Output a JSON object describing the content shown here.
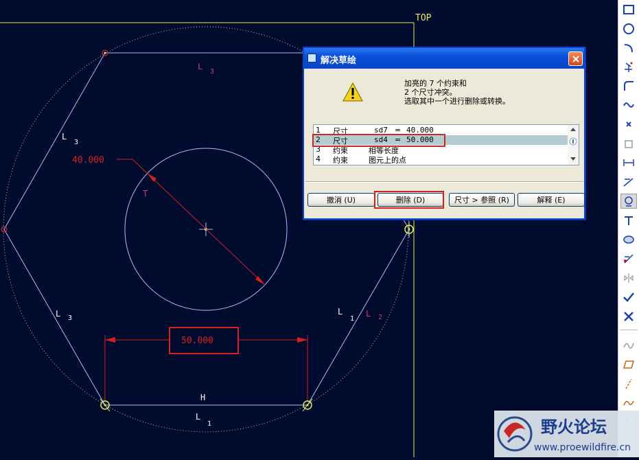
{
  "sketch": {
    "view_label": "TOP",
    "dim_diameter": "40.000",
    "dim_width": "50.000",
    "constraint_labels": {
      "L3_top": [
        "L",
        "3"
      ],
      "L3_upper_left": [
        "L",
        "3"
      ],
      "L3_lower_left": [
        "L",
        "3"
      ],
      "L1_right": [
        "L",
        "1"
      ],
      "L2_right": [
        "L",
        "2"
      ],
      "L1_bottom": [
        "L",
        "1"
      ],
      "H_bottom": "H",
      "T_circle": "T"
    },
    "colors": {
      "background": "#000b2e",
      "geometry": "#a3c2ff",
      "dimension": "#d71f1f",
      "constraint": "#c83c6a",
      "reference_line": "#e8e85a"
    }
  },
  "dialog": {
    "title": "解决草绘",
    "close_icon": "close-icon",
    "warning_icon": "warning-icon",
    "message": {
      "line1": "加亮的 7 个约束和",
      "line2": "2 个尺寸冲突。",
      "line3": "选取其中一个进行删除或转换。"
    },
    "list_items": [
      {
        "num": "1",
        "type": "尺寸",
        "name": "sd7",
        "eq": "=",
        "value": "40.000"
      },
      {
        "num": "2",
        "type": "尺寸",
        "name": "sd4",
        "eq": "=",
        "value": "50.000"
      },
      {
        "num": "3",
        "type": "约束",
        "desc": "相等长度"
      },
      {
        "num": "4",
        "type": "约束",
        "desc": "图元上的点"
      }
    ],
    "selected_index": 1,
    "buttons": {
      "undo": "撤消 (U)",
      "delete": "删除 (D)",
      "dim_to_ref": "尺寸 > 参照 (R)",
      "explain": "解释 (E)"
    }
  },
  "toolbar": {
    "icons": [
      "rectangle-icon",
      "circle-icon",
      "arc-icon",
      "point-icon",
      "fillet-icon",
      "spline-icon",
      "cross-point-icon",
      "offset-icon",
      "dimension-icon",
      "modify-dimension-icon",
      "constraint-icon",
      "text-icon",
      "palette-icon",
      "trim-icon",
      "mirror-icon",
      "check-icon",
      "cancel-icon",
      "sketch-cosmetic-icon",
      "datum-plane-icon",
      "datum-axis-icon",
      "datum-curve-icon",
      "datum-point-icon"
    ],
    "active_icon": "constraint-icon"
  },
  "watermark": {
    "title": "野火论坛",
    "url": "www.proewildfire.cn"
  }
}
